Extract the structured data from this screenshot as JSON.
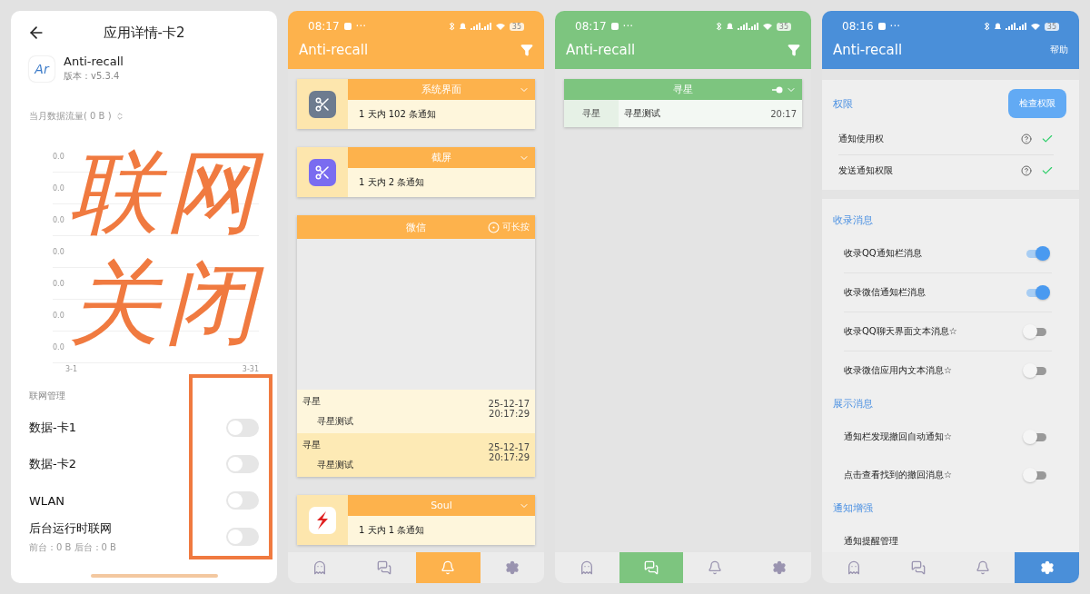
{
  "app_detail": {
    "title": "应用详情-卡2",
    "app": {
      "logo_text": "Ar",
      "name": "Anti-recall",
      "version": "版本：v5.3.4"
    },
    "usage_label": "当月数据流量( 0 B )",
    "usage_chart": {
      "y_labels": [
        "0.0",
        "0.0",
        "0.0",
        "0.0",
        "0.0",
        "0.0",
        "0.0"
      ],
      "x_labels": [
        "3-1",
        "3-31"
      ]
    },
    "section": "联网管理",
    "toggles": [
      {
        "label": "数据-卡1",
        "on": false
      },
      {
        "label": "数据-卡2",
        "on": false
      },
      {
        "label": "WLAN",
        "on": false
      },
      {
        "label": "后台运行时联网",
        "sub": "前台：0 B  后台：0 B",
        "on": false
      }
    ],
    "annotation": {
      "lines": [
        "联网",
        "关闭"
      ]
    }
  },
  "notif_screen": {
    "status": {
      "time": "08:17",
      "more": "···",
      "battery": "35"
    },
    "title": "Anti-recall",
    "cards": [
      {
        "kind": "tool",
        "title": "系统界面",
        "summary": "1 天内 102 条通知",
        "color": "#6d7b8f"
      },
      {
        "kind": "tool",
        "title": "截屏",
        "summary": "1 天内 2 条通知",
        "color": "#7a6cf0"
      },
      {
        "kind": "messages",
        "title": "微信",
        "hint": "可长按",
        "messages": [
          {
            "sender": "寻星",
            "text": "寻星测试",
            "date": "25-12-17",
            "time": "20:17:29",
            "selected": false
          },
          {
            "sender": "寻星",
            "text": "寻星测试",
            "date": "25-12-17",
            "time": "20:17:29",
            "selected": true
          }
        ]
      },
      {
        "kind": "logo",
        "title": "Soul",
        "summary": "1 天内 1 条通知"
      }
    ],
    "nav": [
      {
        "selected": false
      },
      {
        "selected": false
      },
      {
        "selected": true
      },
      {
        "selected": false
      }
    ]
  },
  "wechat_screen": {
    "status": {
      "time": "08:17",
      "more": "···",
      "battery": "35"
    },
    "title": "Anti-recall",
    "card": {
      "title": "寻星",
      "rows": [
        {
          "sender": "寻星",
          "text": "寻星测试",
          "time": "20:17"
        }
      ]
    },
    "nav": [
      {
        "selected": false
      },
      {
        "selected": true
      },
      {
        "selected": false
      },
      {
        "selected": false
      }
    ]
  },
  "settings_screen": {
    "status": {
      "time": "08:16",
      "more": "···",
      "battery": "35"
    },
    "title": "Anti-recall",
    "help": "帮助",
    "permissions": {
      "title": "权限",
      "button": "检查权限",
      "rows": [
        {
          "label": "通知使用权",
          "granted": true
        },
        {
          "label": "发送通知权限",
          "granted": true
        }
      ]
    },
    "sections": [
      {
        "title": "收录消息",
        "rows": [
          {
            "kind": "toggle",
            "label": "收录QQ通知栏消息",
            "on": true
          },
          {
            "kind": "toggle",
            "label": "收录微信通知栏消息",
            "on": true
          },
          {
            "kind": "toggle",
            "label": "收录QQ聊天界面文本消息☆",
            "on": false
          },
          {
            "kind": "toggle",
            "label": "收录微信应用内文本消息☆",
            "on": false
          }
        ]
      },
      {
        "title": "展示消息",
        "rows": [
          {
            "kind": "toggle",
            "label": "通知栏发现撤回自动通知☆",
            "on": false
          },
          {
            "kind": "toggle",
            "label": "点击查看找到的撤回消息☆",
            "on": false
          }
        ]
      },
      {
        "title": "通知增强",
        "rows": [
          {
            "kind": "link",
            "label": "通知提醒管理"
          }
        ]
      }
    ],
    "nav": [
      {
        "selected": false
      },
      {
        "selected": false
      },
      {
        "selected": false
      },
      {
        "selected": true
      }
    ]
  }
}
